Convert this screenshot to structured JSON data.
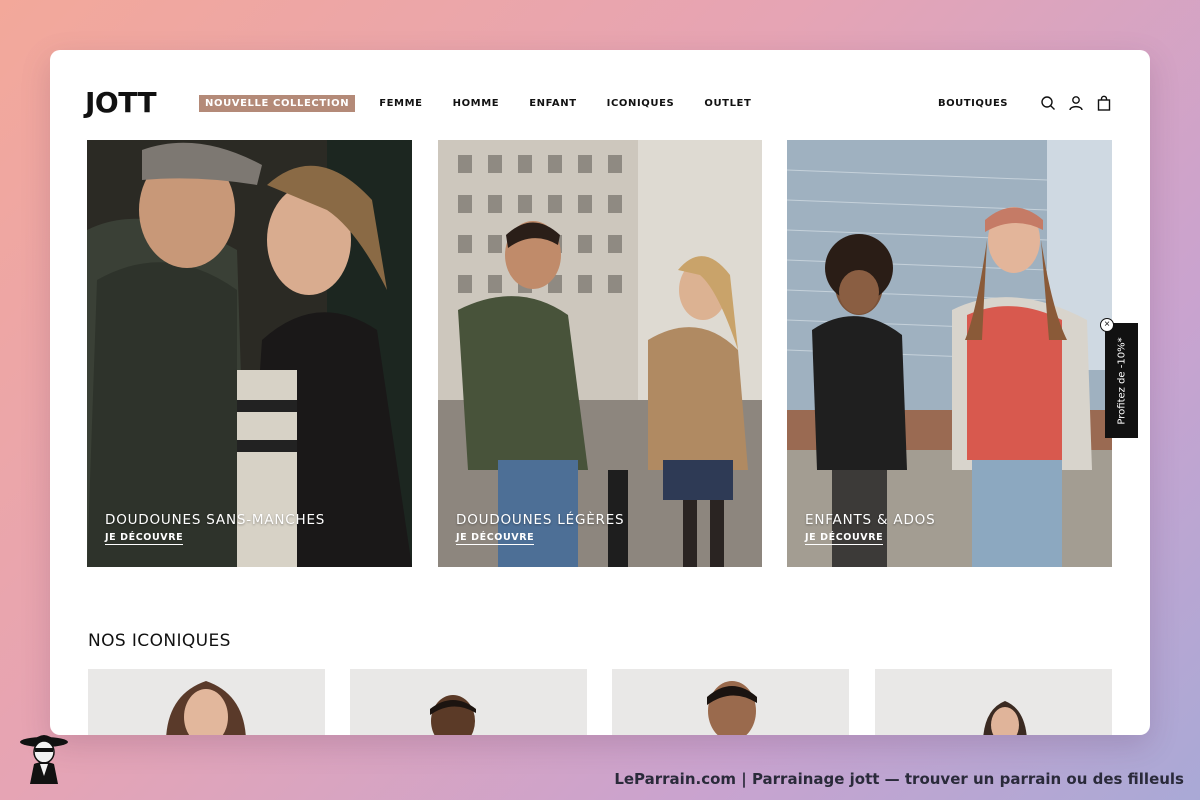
{
  "header": {
    "logo": "JOTT",
    "nav": [
      "NOUVELLE COLLECTION",
      "FEMME",
      "HOMME",
      "ENFANT",
      "ICONIQUES",
      "OUTLET"
    ],
    "boutiques": "BOUTIQUES",
    "icons": [
      "search-icon",
      "account-icon",
      "bag-icon"
    ]
  },
  "hero": {
    "cards": [
      {
        "title": "DOUDOUNES SANS-MANCHES",
        "link": "JE DÉCOUVRE"
      },
      {
        "title": "DOUDOUNES LÉGÈRES",
        "link": "JE DÉCOUVRE"
      },
      {
        "title": "ENFANTS & ADOS",
        "link": "JE DÉCOUVRE"
      }
    ]
  },
  "promo": {
    "text": "Profitez de -10%*",
    "close": "×"
  },
  "section": {
    "title": "NOS ICONIQUES"
  },
  "colors": {
    "accent": "#b48a78",
    "promo_bg": "#111111"
  },
  "footer": {
    "text": "LeParrain.com | Parrainage jott — trouver un parrain ou des filleuls"
  }
}
